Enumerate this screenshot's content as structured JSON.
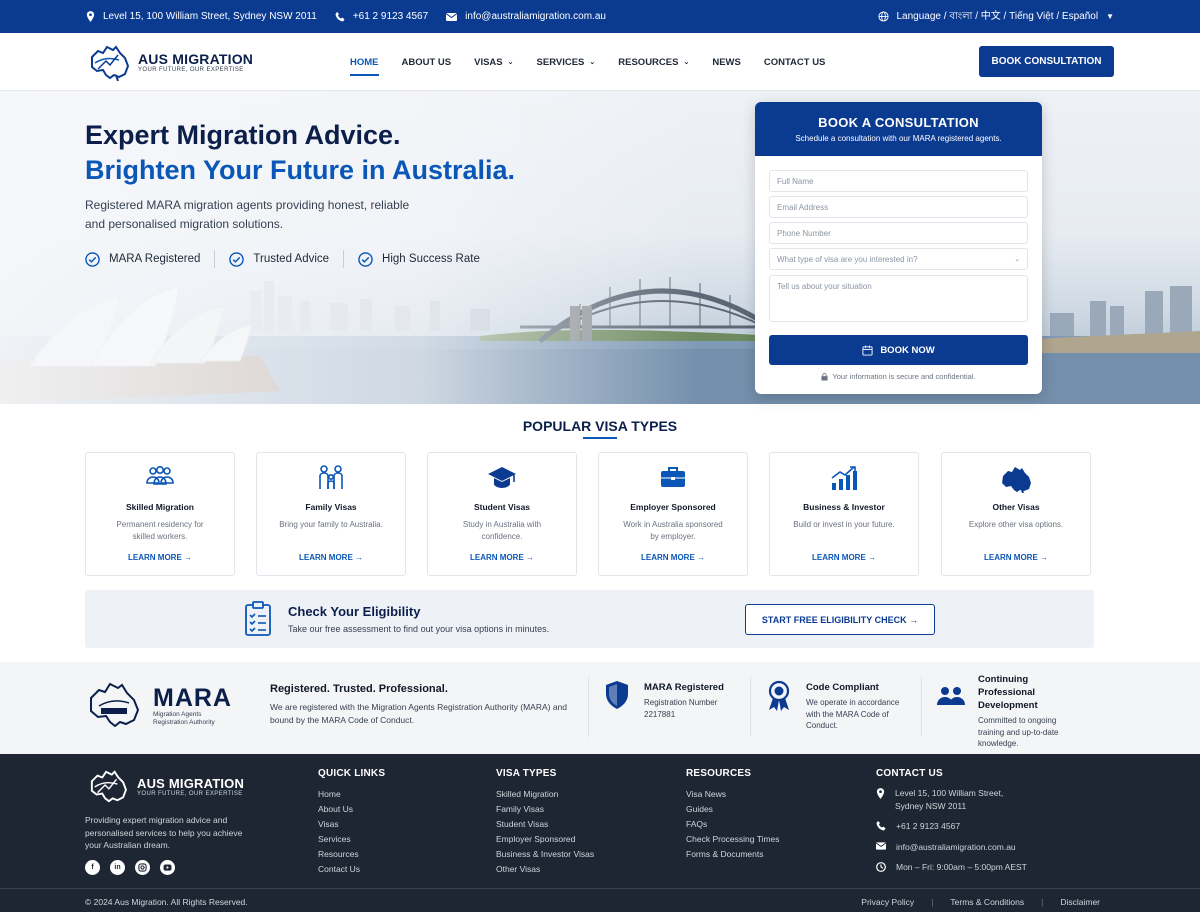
{
  "topbar": {
    "address": "Level 15, 100 William Street, Sydney NSW 2011",
    "phone": "+61 2 9123 4567",
    "email": "info@australiamigration.com.au",
    "language": "Language / বাংলা / 中文 / Tiếng Việt / Español"
  },
  "header": {
    "logo_name": "AUS MIGRATION",
    "logo_tag": "YOUR FUTURE, OUR EXPERTISE",
    "nav": [
      "HOME",
      "ABOUT US",
      "VISAS",
      "SERVICES",
      "RESOURCES",
      "NEWS",
      "CONTACT US"
    ],
    "book_button": "BOOK CONSULTATION"
  },
  "hero": {
    "title_line1": "Expert Migration Advice.",
    "title_line2": "Brighten Your Future in Australia.",
    "subtitle": "Registered MARA migration agents providing honest, reliable and personalised migration solutions.",
    "checks": [
      "MARA Registered",
      "Trusted Advice",
      "High Success Rate"
    ]
  },
  "booking_form": {
    "title": "BOOK A CONSULTATION",
    "subtitle": "Schedule a consultation with our MARA registered agents.",
    "full_name_placeholder": "Full Name",
    "email_placeholder": "Email Address",
    "phone_placeholder": "Phone Number",
    "visa_select_placeholder": "What type of visa are you interested in?",
    "situation_placeholder": "Tell us about your situation",
    "submit": "BOOK NOW",
    "note": "Your information is secure and confidential."
  },
  "popular_visas": {
    "title": "POPULAR VISA TYPES",
    "cards": [
      {
        "name": "Skilled Migration",
        "desc": "Permanent residency for skilled workers.",
        "link": "LEARN MORE →",
        "icon": "people-group-icon"
      },
      {
        "name": "Family Visas",
        "desc": "Bring your family to Australia.",
        "link": "LEARN MORE →",
        "icon": "family-icon"
      },
      {
        "name": "Student Visas",
        "desc": "Study in Australia with confidence.",
        "link": "LEARN MORE →",
        "icon": "graduation-cap-icon"
      },
      {
        "name": "Employer Sponsored",
        "desc": "Work in Australia sponsored by employer.",
        "link": "LEARN MORE →",
        "icon": "briefcase-icon"
      },
      {
        "name": "Business & Investor",
        "desc": "Build or invest in your future.",
        "link": "LEARN MORE →",
        "icon": "growth-chart-icon"
      },
      {
        "name": "Other Visas",
        "desc": "Explore other visa options.",
        "link": "LEARN MORE →",
        "icon": "australia-map-icon"
      }
    ]
  },
  "eligibility": {
    "title": "Check Your Eligibility",
    "subtitle": "Take our free assessment to find out your visa options in minutes.",
    "button": "START FREE ELIGIBILITY CHECK →"
  },
  "mara": {
    "logo_big": "MARA",
    "logo_small": "Migration Agents Registration Authority",
    "heading": "Registered. Trusted. Professional.",
    "description": "We are registered with the Migration Agents Registration Authority (MARA) and bound by the MARA Code of Conduct.",
    "badges": [
      {
        "title": "MARA Registered",
        "desc": "Registration Number 2217881"
      },
      {
        "title": "Code Compliant",
        "desc": "We operate in accordance with the MARA Code of Conduct."
      },
      {
        "title": "Continuing Professional Development",
        "desc": "Committed to ongoing training and up-to-date knowledge."
      }
    ]
  },
  "footer": {
    "logo_name": "AUS MIGRATION",
    "logo_tag": "YOUR FUTURE, OUR EXPERTISE",
    "about": "Providing expert migration advice and personalised services to help you achieve your Australian dream.",
    "quick_links": {
      "title": "QUICK LINKS",
      "items": [
        "Home",
        "About Us",
        "Visas",
        "Services",
        "Resources",
        "Contact Us"
      ]
    },
    "visa_types": {
      "title": "VISA TYPES",
      "items": [
        "Skilled Migration",
        "Family Visas",
        "Student Visas",
        "Employer Sponsored",
        "Business & Investor Visas",
        "Other Visas"
      ]
    },
    "resources": {
      "title": "RESOURCES",
      "items": [
        "Visa News",
        "Guides",
        "FAQs",
        "Check Processing Times",
        "Forms & Documents"
      ]
    },
    "contact": {
      "title": "CONTACT US",
      "address": "Level 15, 100 William Street, Sydney NSW 2011",
      "phone": "+61 2 9123 4567",
      "email": "info@australiamigration.com.au",
      "hours": "Mon – Fri: 9:00am – 5:00pm AEST"
    },
    "copyright": "© 2024 Aus Migration. All Rights Reserved.",
    "legal": [
      "Privacy Policy",
      "Terms & Conditions",
      "Disclaimer"
    ]
  },
  "colors": {
    "primary": "#0b3a91",
    "accent": "#0b57b8",
    "footer_bg": "#1e2633"
  }
}
